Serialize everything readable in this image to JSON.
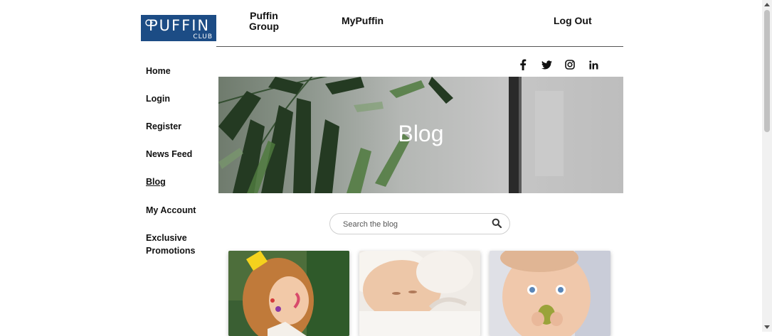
{
  "logo": {
    "name": "PUFFIN",
    "sub": "CLUB"
  },
  "top_nav": {
    "puffin_group": "Puffin Group",
    "mypuffin": "MyPuffin",
    "logout": "Log Out"
  },
  "social": {
    "facebook": "f",
    "twitter": "twitter-icon",
    "instagram": "instagram-icon",
    "linkedin": "in"
  },
  "sidebar": {
    "items": [
      {
        "label": "Home"
      },
      {
        "label": "Login"
      },
      {
        "label": "Register"
      },
      {
        "label": "News Feed"
      },
      {
        "label": "Blog",
        "active": true
      },
      {
        "label": "My Account"
      },
      {
        "label": "Exclusive Promotions"
      }
    ]
  },
  "hero": {
    "title": "Blog"
  },
  "search": {
    "placeholder": "Search the blog"
  },
  "colors": {
    "brand": "#1c4c85",
    "text": "#111111"
  }
}
